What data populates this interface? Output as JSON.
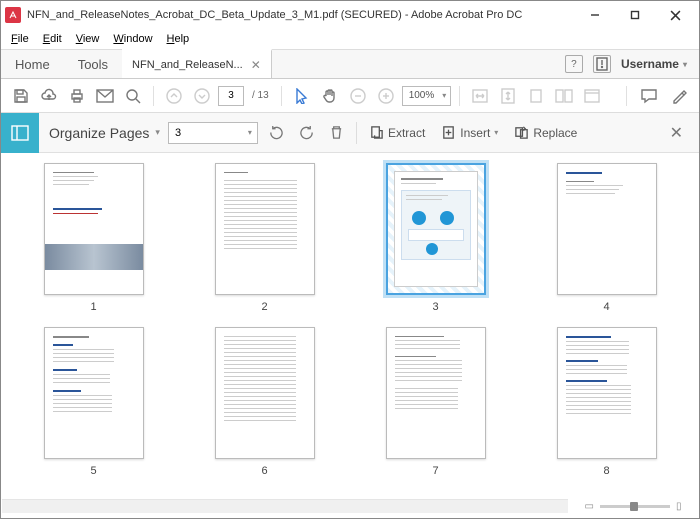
{
  "window": {
    "title": "NFN_and_ReleaseNotes_Acrobat_DC_Beta_Update_3_M1.pdf (SECURED) - Adobe Acrobat Pro DC"
  },
  "menu": {
    "file": "File",
    "edit": "Edit",
    "view": "View",
    "window": "Window",
    "help": "Help"
  },
  "tabs": {
    "home": "Home",
    "tools": "Tools",
    "doc": "NFN_and_ReleaseN...",
    "username": "Username"
  },
  "toolbar": {
    "page_current": "3",
    "page_total": "/ 13",
    "zoom": "100%"
  },
  "organize": {
    "title": "Organize Pages",
    "page_select": "3",
    "extract": "Extract",
    "insert": "Insert",
    "replace": "Replace"
  },
  "thumbnails": [
    {
      "num": "1",
      "selected": false
    },
    {
      "num": "2",
      "selected": false
    },
    {
      "num": "3",
      "selected": true
    },
    {
      "num": "4",
      "selected": false
    },
    {
      "num": "5",
      "selected": false
    },
    {
      "num": "6",
      "selected": false
    },
    {
      "num": "7",
      "selected": false
    },
    {
      "num": "8",
      "selected": false
    }
  ]
}
